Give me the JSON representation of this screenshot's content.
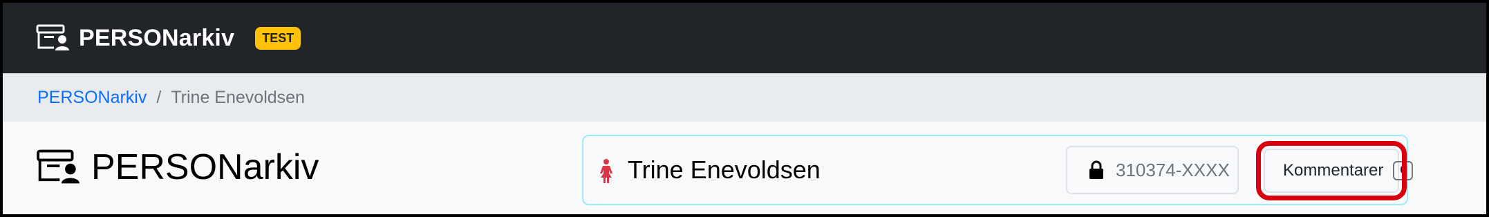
{
  "navbar": {
    "brand": "PERSONarkiv",
    "env_badge": "TEST",
    "brand_icon": "archive-person-icon"
  },
  "breadcrumb": {
    "root": "PERSONarkiv",
    "separator": "/",
    "current": "Trine Enevoldsen"
  },
  "main": {
    "title": "PERSONarkiv",
    "title_icon": "archive-person-icon"
  },
  "person": {
    "icon": "female-person-icon",
    "name": "Trine Enevoldsen",
    "ssn_icon": "lock-icon",
    "ssn": "310374-XXXX",
    "comments_label": "Kommentarer",
    "comments_count": "0"
  },
  "colors": {
    "navbar_bg": "#212529",
    "badge_bg": "#ffc107",
    "link": "#0d6efd",
    "person_icon": "#dc3545",
    "card_border": "#9eeaf9",
    "highlight": "#d9000d"
  }
}
